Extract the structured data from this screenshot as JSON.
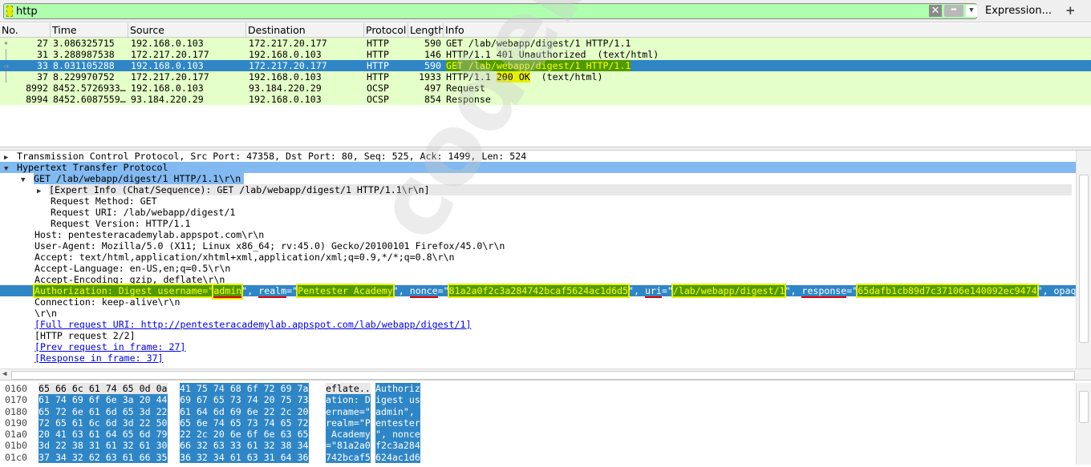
{
  "filter": {
    "value": "http",
    "expression_label": "Expression...",
    "add_label": "+",
    "clear_icon": "clear-x-icon",
    "apply_icon": "arrow-right-icon"
  },
  "packet_list": {
    "columns": [
      "No.",
      "Time",
      "Source",
      "Destination",
      "Protocol",
      "Length",
      "Info"
    ],
    "rows": [
      {
        "no": "27",
        "time": "3.086325715",
        "src": "192.168.0.103",
        "dst": "172.217.20.177",
        "proto": "HTTP",
        "len": "590",
        "info": "GET /lab/webapp/digest/1 HTTP/1.1"
      },
      {
        "no": "31",
        "time": "3.288987538",
        "src": "172.217.20.177",
        "dst": "192.168.0.103",
        "proto": "HTTP",
        "len": "146",
        "info": "HTTP/1.1 401 Unauthorized  (text/html)"
      },
      {
        "no": "33",
        "time": "8.031105288",
        "src": "192.168.0.103",
        "dst": "172.217.20.177",
        "proto": "HTTP",
        "len": "590",
        "info": "GET /lab/webapp/digest/1 HTTP/1.1",
        "selected": true
      },
      {
        "no": "37",
        "time": "8.229970752",
        "src": "172.217.20.177",
        "dst": "192.168.0.103",
        "proto": "HTTP",
        "len": "1933",
        "info_pre": "HTTP/1.1 ",
        "info_hl": "200 OK",
        "info_post": "  (text/html)"
      },
      {
        "no": "8992",
        "time": "8452.5726933…",
        "src": "192.168.0.103",
        "dst": "93.184.220.29",
        "proto": "OCSP",
        "len": "497",
        "info": "Request"
      },
      {
        "no": "8994",
        "time": "8452.6087559…",
        "src": "93.184.220.29",
        "dst": "192.168.0.103",
        "proto": "OCSP",
        "len": "854",
        "info": "Response"
      }
    ],
    "row_color": "#e4ffc7",
    "selected_color": "#2f86c6"
  },
  "details": {
    "tcp": "Transmission Control Protocol, Src Port: 47358, Dst Port: 80, Seq: 525, Ack: 1499, Len: 524",
    "http": "Hypertext Transfer Protocol",
    "get": "GET /lab/webapp/digest/1 HTTP/1.1\\r\\n",
    "expert": "[Expert Info (Chat/Sequence): GET /lab/webapp/digest/1 HTTP/1.1\\r\\n]",
    "method": "Request Method: GET",
    "uri": "Request URI: /lab/webapp/digest/1",
    "version": "Request Version: HTTP/1.1",
    "host": "Host: pentesteracademylab.appspot.com\\r\\n",
    "ua": "User-Agent: Mozilla/5.0 (X11; Linux x86_64; rv:45.0) Gecko/20100101 Firefox/45.0\\r\\n",
    "accept": "Accept: text/html,application/xhtml+xml,application/xml;q=0.9,*/*;q=0.8\\r\\n",
    "lang": "Accept-Language: en-US,en;q=0.5\\r\\n",
    "enc": "Accept-Encoding: gzip, deflate\\r\\n",
    "auth": {
      "a1": "Authorization: Digest username=\"",
      "user": "admin",
      "a2": "\", ",
      "realm_k": "realm",
      "a3": "=\"",
      "realm": "Pentester Academy",
      "a4": "\", ",
      "nonce_k": "nonce",
      "a5": "=\"",
      "nonce": "81a2a0f2c3a284742bcaf5624ac1d6d5",
      "a6": "\", ",
      "uri_k": "uri",
      "a7": "=\"",
      "uri": "/lab/webapp/digest/1",
      "a8": "\", ",
      "resp_k": "response",
      "a9": "=\"",
      "resp": "65dafb1cb89d7c37106e140092ec9474",
      "a10": "\", opaq"
    },
    "conn": "Connection: keep-alive\\r\\n",
    "crlf": "\\r\\n",
    "full": "[Full request URI: http://pentesteracademylab.appspot.com/lab/webapp/digest/1]",
    "req": "[HTTP request 2/2]",
    "prev": "[Prev request in frame: 27]",
    "resp": "[Response in frame: 37]"
  },
  "hex": [
    {
      "off": "0160",
      "b1": "65 66 6c 61 74 65 0d 0a",
      "b2": "41 75 74 68 6f 72 69 7a",
      "a1": "eflate..",
      "a2": "Authoriz"
    },
    {
      "off": "0170",
      "b1": "61 74 69 6f 6e 3a 20 44",
      "b2": "69 67 65 73 74 20 75 73",
      "a1": "ation: D",
      "a2": "igest us"
    },
    {
      "off": "0180",
      "b1": "65 72 6e 61 6d 65 3d 22",
      "b2": "61 64 6d 69 6e 22 2c 20",
      "a1": "ername=\"",
      "a2": "admin\", "
    },
    {
      "off": "0190",
      "b1": "72 65 61 6c 6d 3d 22 50",
      "b2": "65 6e 74 65 73 74 65 72",
      "a1": "realm=\"P",
      "a2": "entester"
    },
    {
      "off": "01a0",
      "b1": "20 41 63 61 64 65 6d 79",
      "b2": "22 2c 20 6e 6f 6e 63 65",
      "a1": " Academy",
      "a2": "\", nonce"
    },
    {
      "off": "01b0",
      "b1": "3d 22 38 31 61 32 61 30",
      "b2": "66 32 63 33 61 32 38 34",
      "a1": "=\"81a2a0",
      "a2": "f2c3a284"
    },
    {
      "off": "01c0",
      "b1": "37 34 32 62 63 61 66 35",
      "b2": "36 32 34 61 63 31 64 36",
      "a1": "742bcaf5",
      "a2": "624ac1d6"
    }
  ],
  "watermark": "codeby.net"
}
